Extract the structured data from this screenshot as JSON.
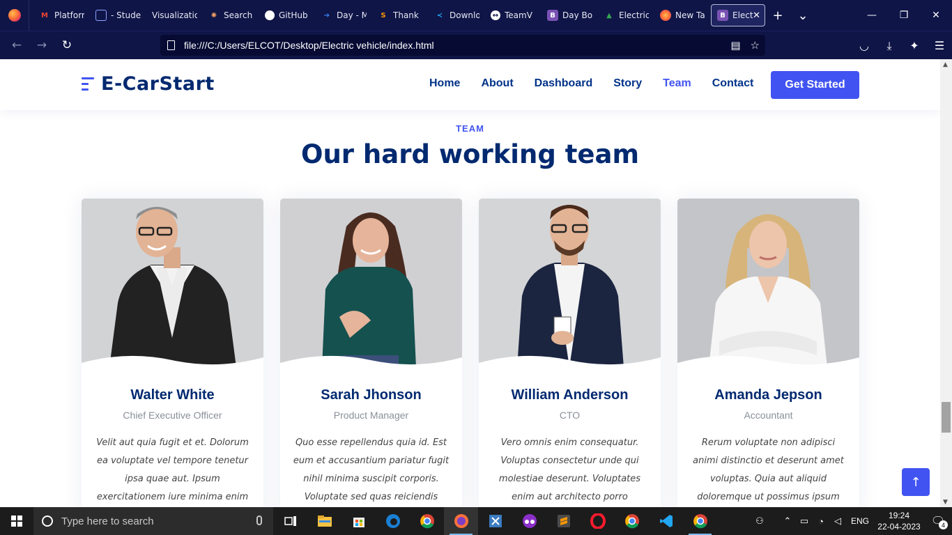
{
  "browser": {
    "tabs": [
      {
        "label": "",
        "icon": "firefox-menu-icon",
        "color": "#ff7139"
      },
      {
        "label": "Platform",
        "icon": "gmail-icon",
        "color": "#ea4335"
      },
      {
        "label": "- Student",
        "icon": "generic-page-icon",
        "color": "#5a7bd6"
      },
      {
        "label": "Visualization",
        "icon": "",
        "color": ""
      },
      {
        "label": "Search",
        "icon": "search-sparkle-icon",
        "color": "#f4a261"
      },
      {
        "label": "GitHub",
        "icon": "github-icon",
        "color": "#ffffff"
      },
      {
        "label": "Day - M",
        "icon": "dayjs-icon",
        "color": "#3b82f6"
      },
      {
        "label": "Thank",
        "icon": "sublime-icon",
        "color": "#ff9800"
      },
      {
        "label": "Downlo",
        "icon": "vscode-icon",
        "color": "#22a6f2"
      },
      {
        "label": "TeamV",
        "icon": "teamviewer-icon",
        "color": "#ffffff"
      },
      {
        "label": "Day Bo",
        "icon": "bootstrap-icon",
        "color": "#7952b3"
      },
      {
        "label": "Electric",
        "icon": "google-drive-icon",
        "color": "#34a853"
      },
      {
        "label": "New Ta",
        "icon": "firefox-icon",
        "color": "#ff7139"
      }
    ],
    "active_tab": {
      "label": "Elect",
      "icon": "bootstrap-icon",
      "color": "#7952b3"
    },
    "url": "file:///C:/Users/ELCOT/Desktop/Electric vehicle/index.html"
  },
  "site": {
    "brand": "E-CarStart",
    "nav": [
      "Home",
      "About",
      "Dashboard",
      "Story",
      "Team",
      "Contact"
    ],
    "active_nav": "Team",
    "cta": "Get Started",
    "section_label": "TEAM",
    "section_title": "Our hard working team",
    "accent_color": "#4154f1",
    "heading_color": "#012970",
    "members": [
      {
        "name": "Walter White",
        "role": "Chief Executive Officer",
        "bio": "Velit aut quia fugit et et. Dolorum ea voluptate vel tempore tenetur ipsa quae aut. Ipsum exercitationem iure minima enim corporis et voluptate."
      },
      {
        "name": "Sarah Jhonson",
        "role": "Product Manager",
        "bio": "Quo esse repellendus quia id. Est eum et accusantium pariatur fugit nihil minima suscipit corporis. Voluptate sed quas reiciendis animi"
      },
      {
        "name": "William Anderson",
        "role": "CTO",
        "bio": "Vero omnis enim consequatur. Voluptas consectetur unde qui molestiae deserunt. Voluptates enim aut architecto porro aspernatur"
      },
      {
        "name": "Amanda Jepson",
        "role": "Accountant",
        "bio": "Rerum voluptate non adipisci animi distinctio et deserunt amet voluptas. Quia aut aliquid doloremque ut possimus ipsum officia."
      }
    ]
  },
  "taskbar": {
    "search_placeholder": "Type here to search",
    "apps": [
      "task-view-icon",
      "file-explorer-icon",
      "store-icon",
      "edge-icon",
      "chrome-icon",
      "firefox-icon",
      "snipping-icon",
      "incognito-icon",
      "sublime-icon",
      "opera-icon",
      "chrome-icon",
      "vscode-icon",
      "chrome-profile-icon"
    ],
    "language": "ENG",
    "time": "19:24",
    "date": "22-04-2023",
    "notifications": "4"
  }
}
